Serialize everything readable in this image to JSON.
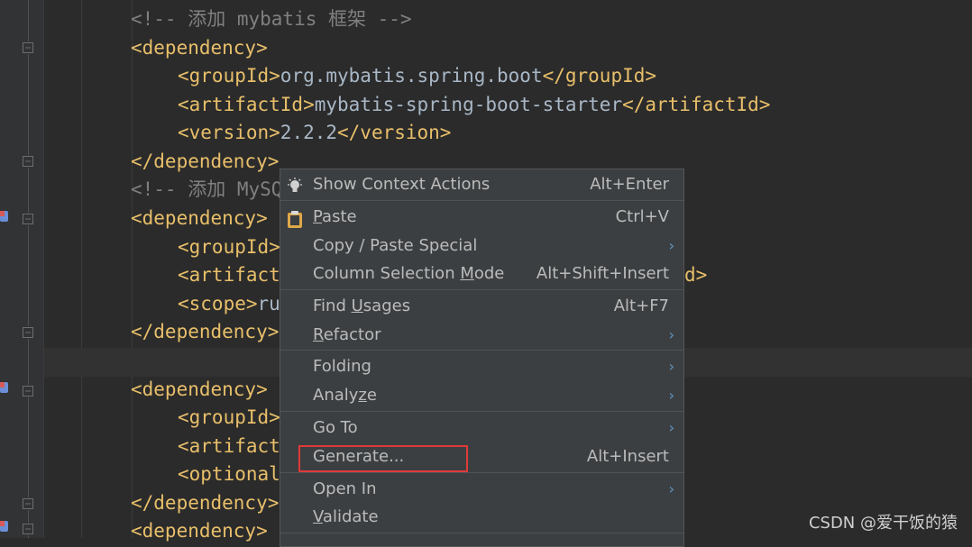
{
  "editor": {
    "comment1": "<!-- 添加 mybatis 框架 -->",
    "dep_open": "<dependency>",
    "dep_close": "</dependency>",
    "groupId_line": {
      "open": "<groupId>",
      "value": "org.mybatis.spring.boot",
      "close": "</groupId>"
    },
    "artifactId_line": {
      "open": "<artifactId>",
      "value": "mybatis-spring-boot-starter",
      "close": "</artifactId>"
    },
    "version_line": {
      "open": "<version>",
      "value": "2.2.2",
      "close": "</version>"
    },
    "comment2": "<!-- 添加 MySQ",
    "groupId_partial": "<groupId>",
    "artifact_partial": "<artifact",
    "artifact_tail": "d>",
    "scope_partial": {
      "open": "<scope>",
      "value": "ru"
    },
    "optional_partial": "<optional"
  },
  "context_menu": {
    "items": [
      {
        "label": "Show Context Actions",
        "shortcut": "Alt+Enter",
        "icon": "lightbulb-icon"
      },
      {
        "label_pre": "",
        "label_u": "P",
        "label_post": "aste",
        "shortcut": "Ctrl+V",
        "icon": "clipboard-icon"
      },
      {
        "label": "Copy / Paste Special",
        "submenu": true
      },
      {
        "label_pre": "Column Selection ",
        "label_u": "M",
        "label_post": "ode",
        "shortcut": "Alt+Shift+Insert"
      },
      {
        "label_pre": "Find ",
        "label_u": "U",
        "label_post": "sages",
        "shortcut": "Alt+F7"
      },
      {
        "label_pre": "",
        "label_u": "R",
        "label_post": "efactor",
        "submenu": true
      },
      {
        "label": "Folding",
        "submenu": true
      },
      {
        "label_pre": "Analy",
        "label_u": "z",
        "label_post": "e",
        "submenu": true
      },
      {
        "label": "Go To",
        "submenu": true
      },
      {
        "label": "Generate...",
        "shortcut": "Alt+Insert"
      },
      {
        "label": "Open In",
        "submenu": true
      },
      {
        "label_pre": "",
        "label_u": "V",
        "label_post": "alidate"
      }
    ],
    "arrow_glyph": "›"
  },
  "watermark": "CSDN @爱干饭的猿",
  "colors": {
    "background": "#2b2b2b",
    "tag": "#e8bf6a",
    "comment": "#808080",
    "menu_bg": "#3c3f41",
    "highlight_box": "#e03a3a"
  }
}
